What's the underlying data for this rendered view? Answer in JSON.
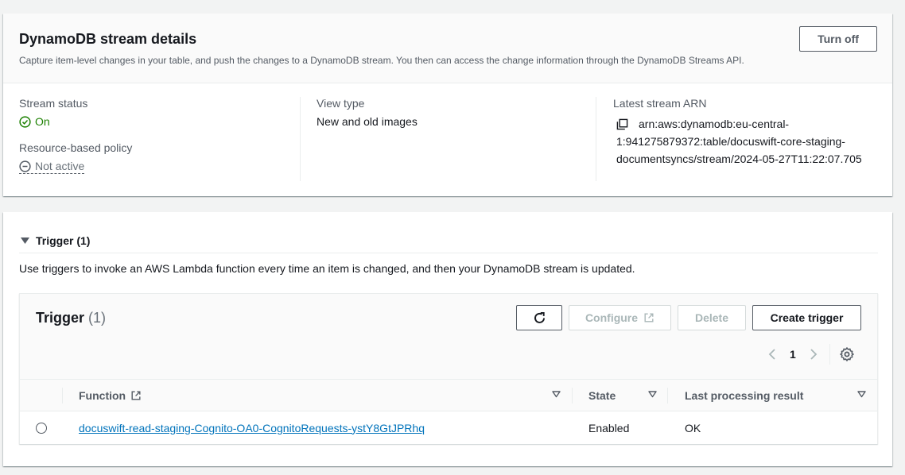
{
  "stream": {
    "title": "DynamoDB stream details",
    "description": "Capture item-level changes in your table, and push the changes to a DynamoDB stream. You then can access the change information through the DynamoDB Streams API.",
    "turn_off_label": "Turn off",
    "status_label": "Stream status",
    "status_value": "On",
    "policy_label": "Resource-based policy",
    "policy_value": "Not active",
    "view_type_label": "View type",
    "view_type_value": "New and old images",
    "arn_label": "Latest stream ARN",
    "arn_line1": "arn:aws:dynamodb:eu-central-",
    "arn_line2": "1:941275879372:table/docuswift-core-staging-",
    "arn_line3": "documentsyncs/stream/2024-05-27T11:22:07.705"
  },
  "trigger_section": {
    "expander_label": "Trigger (1)",
    "description": "Use triggers to invoke an AWS Lambda function every time an item is changed, and then your DynamoDB stream is updated."
  },
  "trigger_table": {
    "title": "Trigger",
    "count": "(1)",
    "configure_label": "Configure",
    "delete_label": "Delete",
    "create_label": "Create trigger",
    "page_number": "1",
    "columns": {
      "function": "Function",
      "state": "State",
      "result": "Last processing result"
    },
    "rows": [
      {
        "function": "docuswift-read-staging-Cognito-OA0-CognitoRequests-ystY8GtJPRhq",
        "state": "Enabled",
        "result": "OK"
      }
    ]
  },
  "colors": {
    "accent_link": "#0073bb",
    "status_on": "#1d8102",
    "muted": "#687078"
  }
}
